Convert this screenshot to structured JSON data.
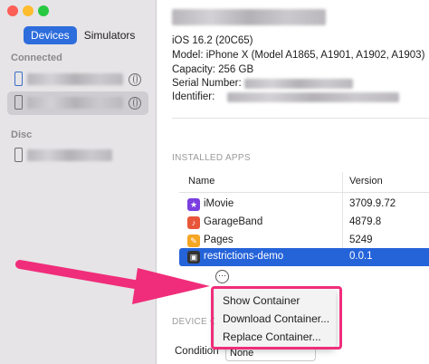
{
  "colors": {
    "close": "#fe5f57",
    "minimize": "#febc2e",
    "zoom": "#28c840",
    "accent": "#2563d9",
    "highlight": "#f02d7a"
  },
  "sidebar": {
    "tabs": [
      {
        "label": "Devices",
        "active": true
      },
      {
        "label": "Simulators",
        "active": false
      }
    ],
    "connected_header": "Connected",
    "disconnected_header": "Disc"
  },
  "device": {
    "ios": "iOS 16.2 (20C65)",
    "model": "Model: iPhone X (Model A1865, A1901, A1902, A1903)",
    "capacity": "Capacity: 256 GB",
    "serial_label": "Serial Number:",
    "identifier_label": "Identifier:"
  },
  "installed_apps": {
    "header": "INSTALLED APPS",
    "columns": [
      "Name",
      "Version"
    ],
    "rows": [
      {
        "name": "iMovie",
        "version": "3709.9.72",
        "icon": "imovie-icon",
        "color": "#7b3fe0",
        "glyph": "★"
      },
      {
        "name": "GarageBand",
        "version": "4879.8",
        "icon": "garageband-icon",
        "color": "#e8563a",
        "glyph": "♪"
      },
      {
        "name": "Pages",
        "version": "5249",
        "icon": "pages-icon",
        "color": "#f5a623",
        "glyph": "✎"
      },
      {
        "name": "restrictions-demo",
        "version": "0.0.1",
        "icon": "app-icon",
        "color": "#333333",
        "glyph": "▣",
        "selected": true
      }
    ]
  },
  "more_button": "⋯",
  "context_menu": {
    "items": [
      "Show Container",
      "Download Container...",
      "Replace Container..."
    ]
  },
  "device_conditions": {
    "header": "DEVICE C",
    "label": "Condition",
    "value": "None"
  }
}
